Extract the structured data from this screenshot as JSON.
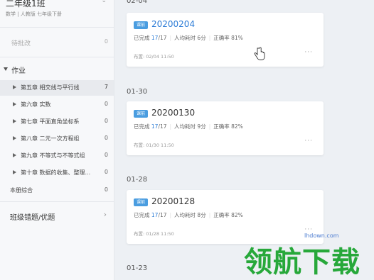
{
  "sidebar": {
    "class_title": "二年级1班",
    "class_subtitle": "数学 | 人教版 七年级下册",
    "pending": {
      "label": "待批改",
      "count": "0"
    },
    "homework_section": "作业",
    "chapters": [
      {
        "label": "第五章 相交线与平行线",
        "count": "7"
      },
      {
        "label": "第六章 实数",
        "count": "0"
      },
      {
        "label": "第七章 平面直角坐标系",
        "count": "0"
      },
      {
        "label": "第八章 二元一次方程组",
        "count": "0"
      },
      {
        "label": "第九章 不等式与不等式组",
        "count": "0"
      },
      {
        "label": "第十章 数据的收集、整理...",
        "count": "0"
      }
    ],
    "comprehensive": {
      "label": "本册综合",
      "count": "0"
    },
    "wrong_questions": "班级错题/优题"
  },
  "main": {
    "groups": [
      {
        "date": "02-04",
        "title": "20200204",
        "tag": "课前",
        "completed_label": "已完成",
        "completed": "17",
        "total": "/17",
        "avg_time": "人均耗时 6分",
        "accuracy": "正确率 81%",
        "published": "布置: 02/04 11:50"
      },
      {
        "date": "01-30",
        "title": "20200130",
        "tag": "课前",
        "completed_label": "已完成",
        "completed": "17",
        "total": "/17",
        "avg_time": "人均耗时 9分",
        "accuracy": "正确率 82%",
        "published": "布置: 01/30 11:50"
      },
      {
        "date": "01-28",
        "title": "20200128",
        "tag": "课前",
        "completed_label": "已完成",
        "completed": "17",
        "total": "/17",
        "avg_time": "人均耗时 8分",
        "accuracy": "正确率 82%",
        "published": "布置: 01/28 11:50"
      },
      {
        "date": "01-23"
      }
    ],
    "more_glyph": "···"
  },
  "watermark": {
    "text": "领航下载",
    "url": "lhdown.com"
  },
  "colors": {
    "accent": "#2b7bd6",
    "tag": "#4a9de0",
    "watermark": "#27a83a"
  }
}
